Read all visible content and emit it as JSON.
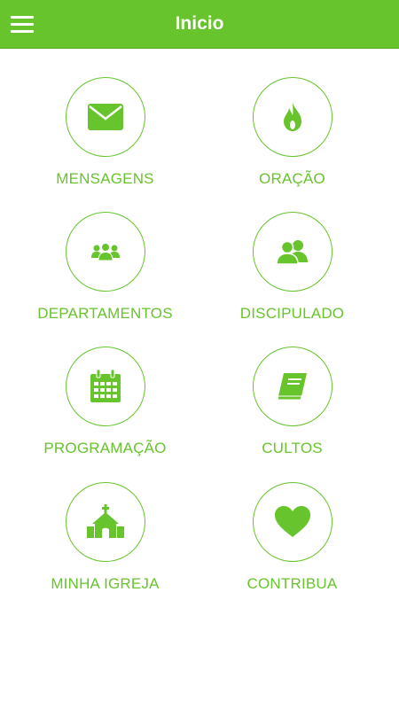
{
  "header": {
    "title": "Inicio",
    "menu_icon": "hamburger-menu-icon"
  },
  "colors": {
    "accent": "#67c42c",
    "background": "#ffffff"
  },
  "menu_items": [
    {
      "label": "MENSAGENS",
      "icon": "envelope-icon"
    },
    {
      "label": "ORAÇÃO",
      "icon": "flame-icon"
    },
    {
      "label": "DEPARTAMENTOS",
      "icon": "group-icon"
    },
    {
      "label": "DISCIPULADO",
      "icon": "users-icon"
    },
    {
      "label": "PROGRAMAÇÃO",
      "icon": "calendar-icon"
    },
    {
      "label": "CULTOS",
      "icon": "book-icon"
    },
    {
      "label": "MINHA IGREJA",
      "icon": "church-icon"
    },
    {
      "label": "CONTRIBUA",
      "icon": "heart-icon"
    }
  ]
}
